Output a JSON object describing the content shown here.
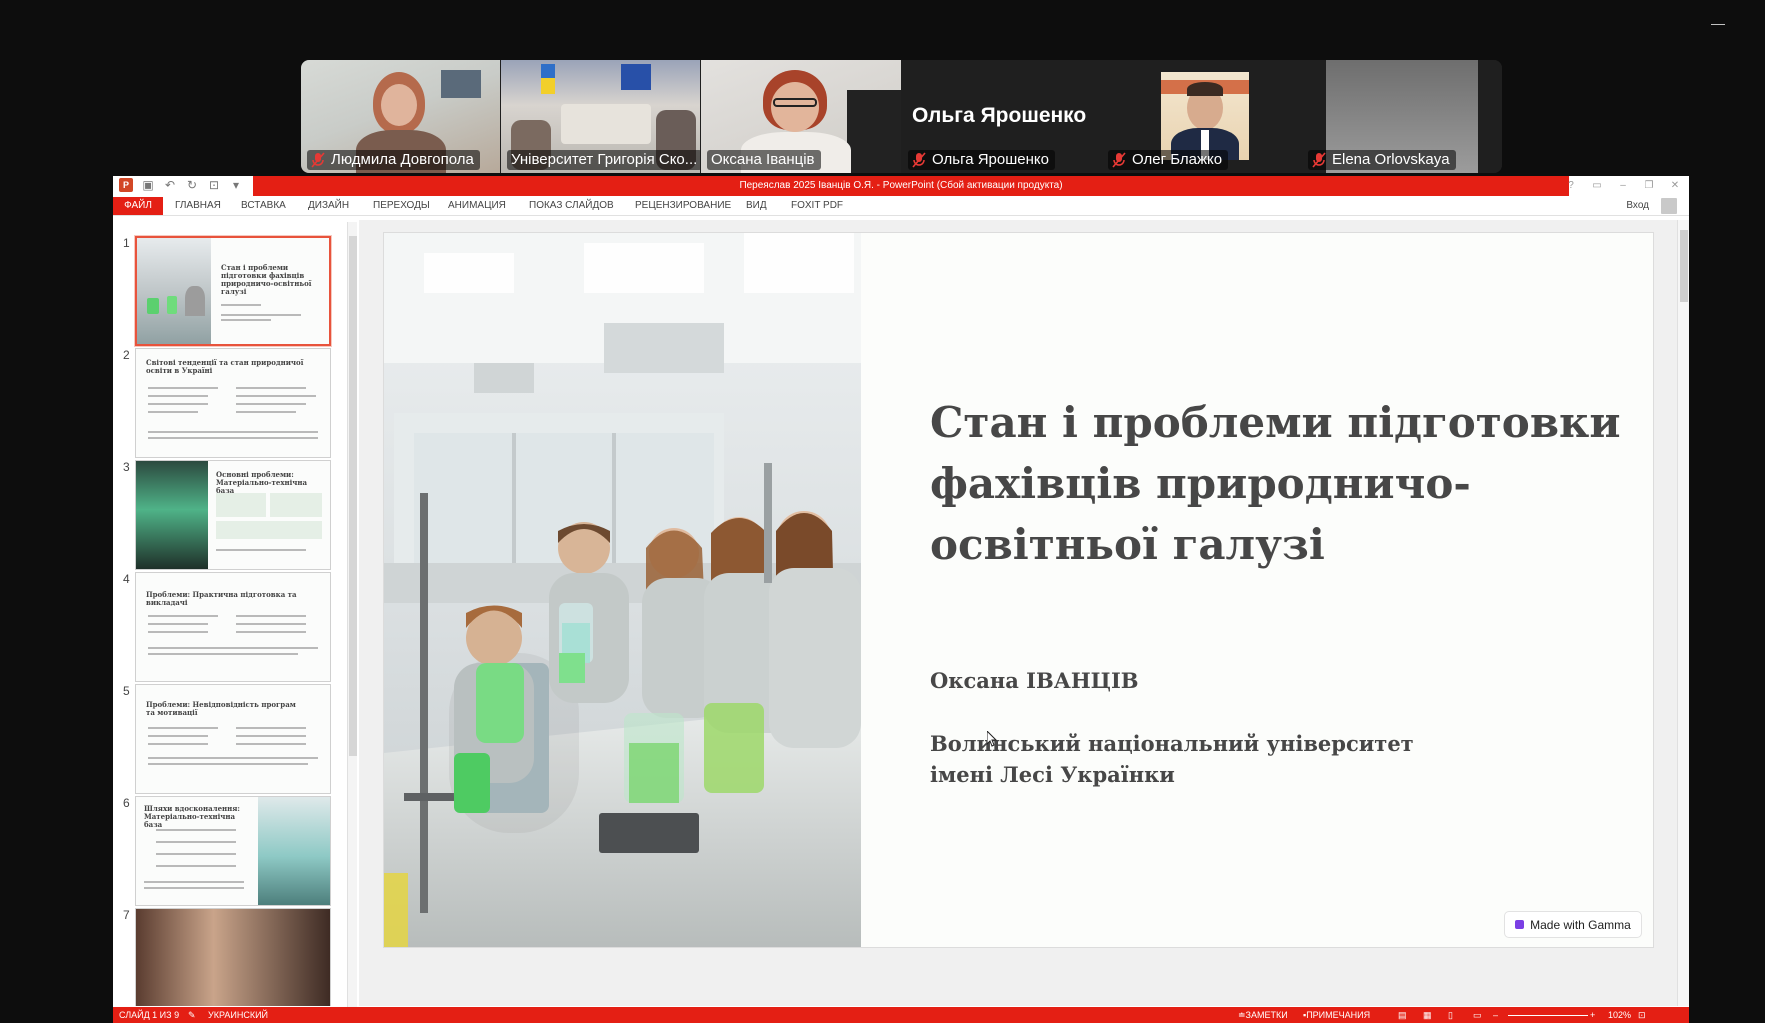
{
  "participants": [
    {
      "name": "Людмила Довгопола",
      "muted": true
    },
    {
      "name": "Університет Григорія Ско...",
      "muted": false
    },
    {
      "name": "Оксана Іванців",
      "muted": false,
      "active": true
    },
    {
      "name": "Ольга Ярошенко",
      "muted": true,
      "display_name": "Ольга Ярошенко"
    },
    {
      "name": "Олег Блажко",
      "muted": true
    },
    {
      "name": "Elena Orlovskaya",
      "muted": true
    }
  ],
  "window": {
    "title": "Переяслав 2025 Іванців О.Я. -  PowerPoint (Сбой активации продукта)",
    "sign_in": "Вход"
  },
  "ribbon": {
    "file": "ФАЙЛ",
    "tabs": [
      "ГЛАВНАЯ",
      "ВСТАВКА",
      "ДИЗАЙН",
      "ПЕРЕХОДЫ",
      "АНИМАЦИЯ",
      "ПОКАЗ СЛАЙДОВ",
      "РЕЦЕНЗИРОВАНИЕ",
      "ВИД",
      "FOXIT PDF"
    ]
  },
  "thumbnails": [
    {
      "num": "1",
      "title": "Стан і проблеми підготовки фахівців природничо-освітньої галузі"
    },
    {
      "num": "2",
      "title": "Світові тенденції та стан природничої освіти в Україні"
    },
    {
      "num": "3",
      "title": "Основні проблеми: Матеріально-технічна база"
    },
    {
      "num": "4",
      "title": "Проблеми: Практична підготовка та викладачі"
    },
    {
      "num": "5",
      "title": "Проблеми: Невідповідність програм та мотивації"
    },
    {
      "num": "6",
      "title": "Шляхи вдосконалення: Матеріально-технічна база"
    },
    {
      "num": "7",
      "title": ""
    }
  ],
  "slide": {
    "title": "Стан і проблеми підготовки фахівців природничо-освітньої галузі",
    "author": "Оксана ІВАНЦІВ",
    "university_line1": "Волинський національний університет",
    "university_line2": "імені Лесі Українки",
    "badge": "Made with Gamma"
  },
  "status": {
    "slide_counter": "СЛАЙД 1 ИЗ 9",
    "language": "УКРАИНСКИЙ",
    "notes": "ЗАМЕТКИ",
    "comments": "ПРИМЕЧАНИЯ",
    "zoom": "102%"
  },
  "colors": {
    "ppt_red": "#e41f14",
    "active_speaker": "#2ed58a",
    "slide_text": "#474747"
  }
}
